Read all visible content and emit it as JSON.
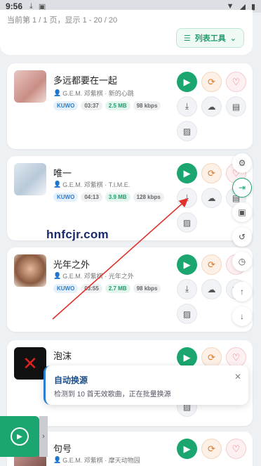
{
  "status": {
    "time": "9:56",
    "icons": [
      "download-icon",
      "image-icon"
    ],
    "right": [
      "wifi",
      "signal",
      "battery"
    ]
  },
  "header": {
    "page_info": "当前第 1 / 1 页，显示 1 - 20 / 20",
    "list_tools": "列表工具"
  },
  "songs": [
    {
      "title": "多远都要在一起",
      "artist": "G.E.M. 邓紫棋 · 新的心跳",
      "source": "KUWO",
      "duration": "03:37",
      "size": "2.5 MB",
      "bitrate": "98 kbps"
    },
    {
      "title": "唯一",
      "artist": "G.E.M. 邓紫棋 · T.I.M.E.",
      "source": "KUWO",
      "duration": "04:13",
      "size": "3.9 MB",
      "bitrate": "128 kbps"
    },
    {
      "title": "光年之外",
      "artist": "G.E.M. 邓紫棋 · 光年之外",
      "source": "KUWO",
      "duration": "03:55",
      "size": "2.7 MB",
      "bitrate": "98 kbps"
    },
    {
      "title": "泡沫",
      "artist": "",
      "source": "",
      "duration": "",
      "size": "",
      "bitrate": ""
    },
    {
      "title": "句号",
      "artist": "G.E.M. 邓紫棋 · 摩天动物园",
      "source": "",
      "duration": "",
      "size": "",
      "bitrate": ""
    }
  ],
  "watermark": "hnfcjr.com",
  "toast": {
    "title": "自动换源",
    "message": "检测到 10 首无效歌曲，正在批量换源"
  },
  "colors": {
    "accent": "#1aa66e",
    "info": "#2b7fd0",
    "arrow": "#e0312c"
  }
}
